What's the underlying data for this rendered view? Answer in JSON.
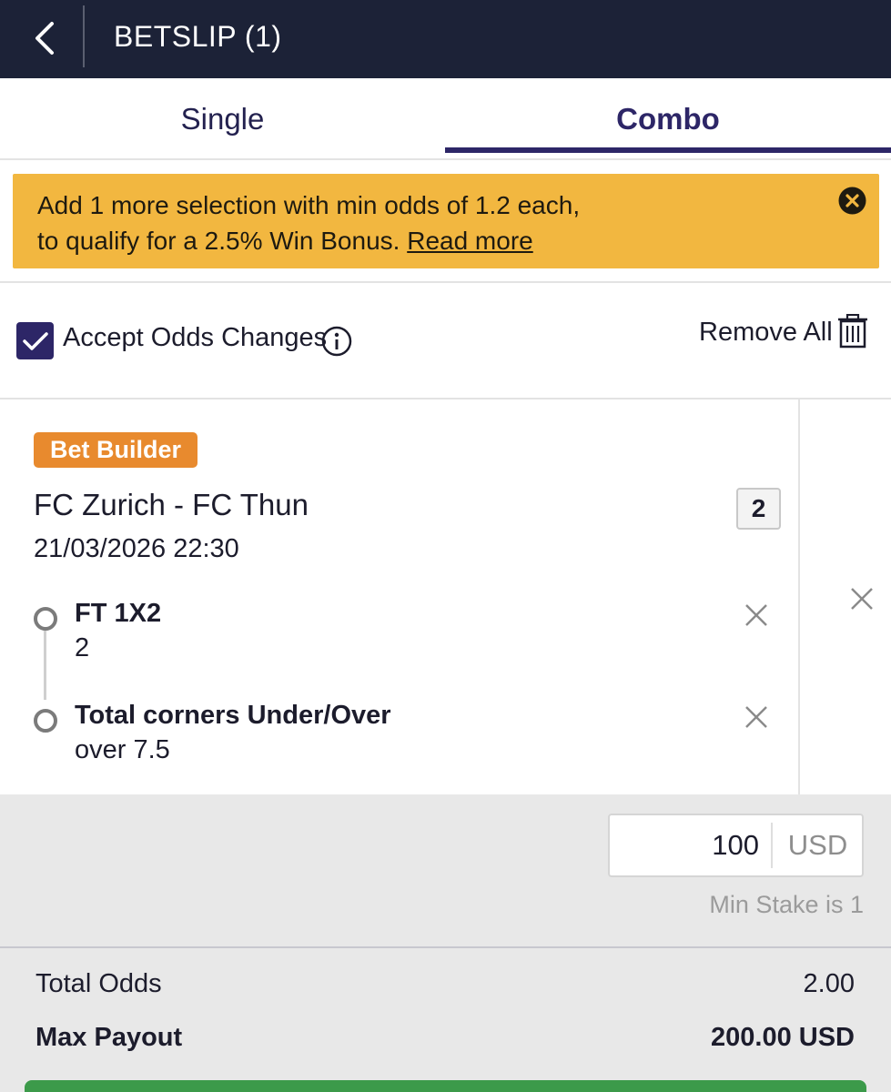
{
  "header": {
    "title": "BETSLIP (1)",
    "back_icon": "chevron-left-icon"
  },
  "tabs": [
    {
      "label": "Single",
      "active": false
    },
    {
      "label": "Combo",
      "active": true
    }
  ],
  "colors": {
    "header_bg": "#1c2237",
    "accent": "#2d2667",
    "banner_bg": "#f2b740",
    "badge_bg": "#e88a2e",
    "place_bet": "#3c9a4a"
  },
  "banner": {
    "line1": "Add 1 more selection with min odds of 1.2 each,",
    "line2": "to qualify for a 2.5% Win Bonus.",
    "link": "Read more",
    "close_icon": "close-circle-icon"
  },
  "options": {
    "accept_odds_label": "Accept Odds Changes",
    "accept_odds_checked": true,
    "info_icon": "info-icon",
    "remove_all_label": "Remove All",
    "trash_icon": "trash-icon"
  },
  "bet": {
    "badge": "Bet Builder",
    "match": "FC Zurich - FC Thun",
    "datetime": "21/03/2026 22:30",
    "odds": "2",
    "selections": [
      {
        "market": "FT 1X2",
        "pick": "2"
      },
      {
        "market": "Total corners Under/Over",
        "pick": "over 7.5"
      }
    ]
  },
  "stake": {
    "value": "100",
    "currency": "USD",
    "min_stake": "Min Stake is 1"
  },
  "summary": {
    "total_odds_label": "Total Odds",
    "total_odds_value": "2.00",
    "max_payout_label": "Max Payout",
    "max_payout_value": "200.00 USD"
  }
}
